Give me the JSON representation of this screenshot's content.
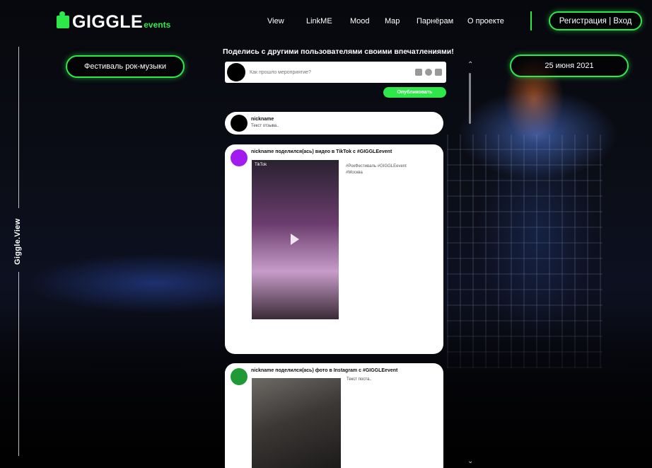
{
  "header": {
    "logo_main": "GIGGLE",
    "logo_sub": "events",
    "nav": [
      "View",
      "LinkME",
      "Mood",
      "Map",
      "Парнёрам",
      "О проекте"
    ],
    "auth_label": "Регистрация | Вход"
  },
  "left": {
    "event_label": "Фестиваль рок-музыки",
    "rail_label": "Giggle.View"
  },
  "right": {
    "date_label": "25 июня 2021"
  },
  "share": {
    "title": "Поделись с другими пользователями своими впечатлениями!",
    "placeholder": "Как прошло мероприятие?",
    "publish_label": "Опубликовать"
  },
  "feed": [
    {
      "name": "nickname",
      "text": "Текст отзыва..",
      "avatar_color": "#000000"
    },
    {
      "name": "nickname поделился(ась) видео в TikTok с #GIGGLEevent",
      "tags": [
        "#РокФестиваль #GIGGLEevent",
        "#Москва"
      ],
      "badge": "TikTok",
      "avatar_color": "#a21cf0"
    },
    {
      "name": "nickname поделился(ась) фото в Instagram с #GIGGLEevent",
      "text": "Текст поста..",
      "avatar_color": "#1f9a36"
    }
  ],
  "colors": {
    "accent": "#2ee84a"
  }
}
